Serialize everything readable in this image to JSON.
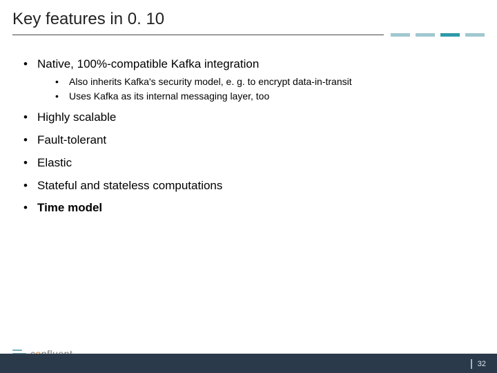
{
  "title": "Key features in 0. 10",
  "bullets": [
    {
      "text": "Native, 100%-compatible Kafka integration",
      "bold": false,
      "sub": [
        "Also inherits Kafka's security model, e. g. to encrypt data-in-transit",
        "Uses Kafka as its internal messaging layer, too"
      ]
    },
    {
      "text": "Highly scalable",
      "bold": false
    },
    {
      "text": "Fault-tolerant",
      "bold": false
    },
    {
      "text": "Elastic",
      "bold": false
    },
    {
      "text": "Stateful and stateless computations",
      "bold": false
    },
    {
      "text": "Time model",
      "bold": true
    }
  ],
  "brand": {
    "name_part1": "c",
    "name_part2": "o",
    "name_part3": "nfluent"
  },
  "page_number": "32"
}
